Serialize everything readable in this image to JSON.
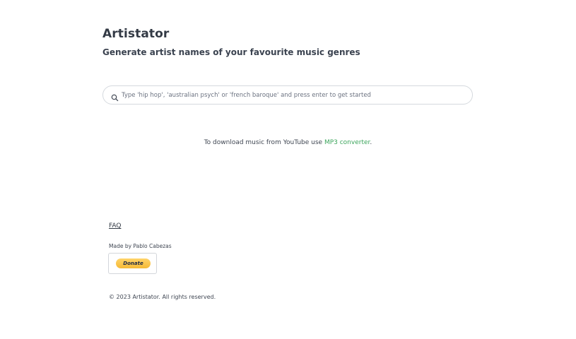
{
  "header": {
    "title": "Artistator",
    "subtitle": "Generate artist names of your favourite music genres"
  },
  "search": {
    "placeholder": "Type 'hip hop', 'australian psych' or 'french baroque' and press enter to get started",
    "value": "",
    "icon": "search-icon"
  },
  "download_note": {
    "text": "To download music from YouTube use ",
    "link_label": "MP3 converter",
    "suffix": ".",
    "link_color": "#3ca55c"
  },
  "footer": {
    "faq_label": "FAQ",
    "made_by": "Made by Pablo Cabezas",
    "donate_label": "Donate",
    "copyright": "© 2023 Artistator. All rights reserved."
  },
  "colors": {
    "donate_yellow": "#ffc439",
    "link_green": "#3ca55c",
    "text_dark": "#333a45"
  }
}
